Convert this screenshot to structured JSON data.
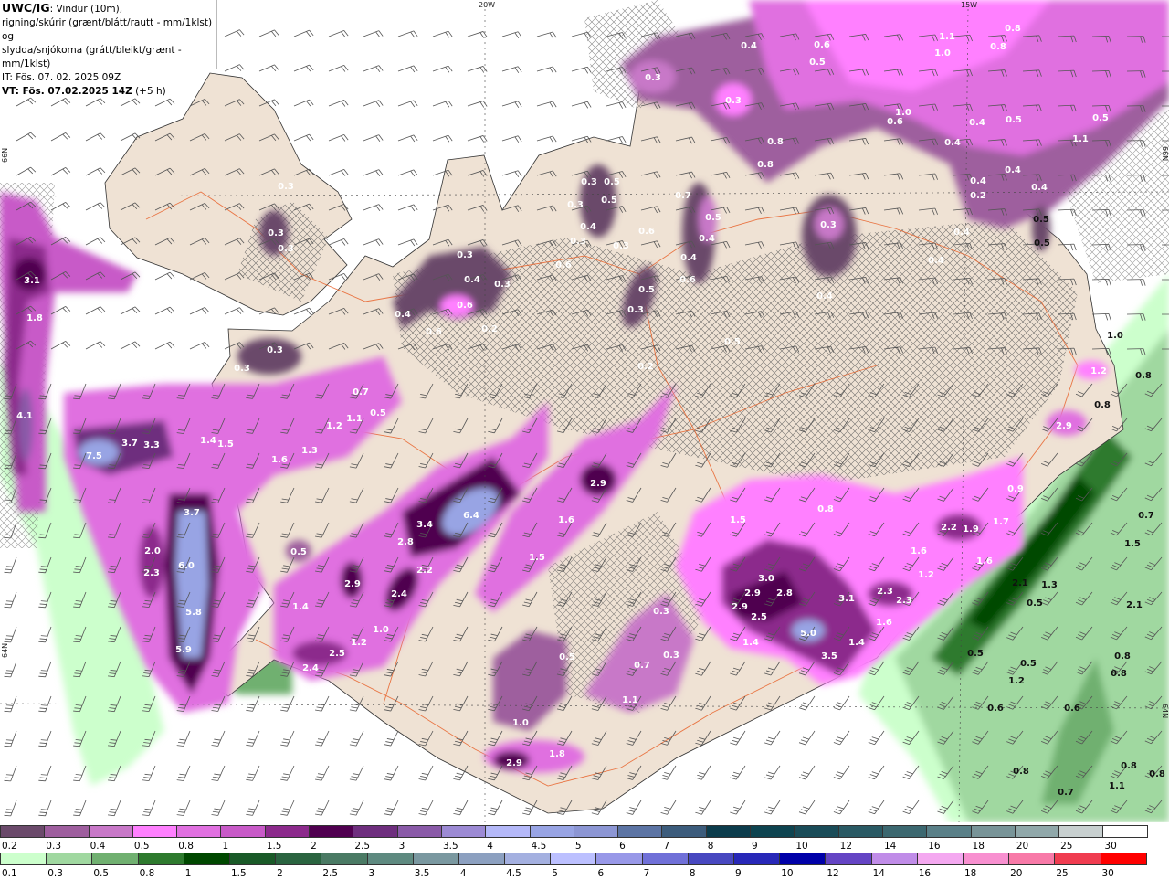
{
  "header": {
    "model": "UWC/IG",
    "line1_rest": ": Vindur (10m),",
    "line2": "rigning/skúrir (grænt/blátt/rautt - mm/1klst) og",
    "line3": "slydda/snjókoma (grátt/bleikt/grænt - mm/1klst)",
    "init_time": "IT: Fös. 07. 02. 2025 09Z",
    "valid_time_bold": "VT: Fös. 07.02.2025 14Z",
    "valid_offset": " (+5 h)"
  },
  "map": {
    "gridlabels": {
      "lon_20w": "20W",
      "lon_15w": "15W",
      "lat_66n_left": "66N",
      "lat_66n_right": "66N",
      "lat_64n_left": "64N",
      "lat_64n_right": "64N"
    },
    "colors": {
      "land": "#efe2d4",
      "sea": "#ffffff",
      "roads": "#e8622a",
      "wind_barbs": "#555555"
    },
    "labels": [
      {
        "v": "3.1",
        "c": "light"
      },
      {
        "v": "1.8",
        "c": "light"
      },
      {
        "v": "4.1",
        "c": "light"
      },
      {
        "v": "7.5",
        "c": "light"
      },
      {
        "v": "3.7",
        "c": "light"
      },
      {
        "v": "3.3",
        "c": "light"
      },
      {
        "v": "1.4",
        "c": "light"
      },
      {
        "v": "1.5",
        "c": "light"
      },
      {
        "v": "1.2",
        "c": "light"
      },
      {
        "v": "1.1",
        "c": "light"
      },
      {
        "v": "0.5",
        "c": "light"
      },
      {
        "v": "0.7",
        "c": "light"
      },
      {
        "v": "1.6",
        "c": "light"
      },
      {
        "v": "1.3",
        "c": "light"
      },
      {
        "v": "3.7",
        "c": "light"
      },
      {
        "v": "2.0",
        "c": "light"
      },
      {
        "v": "2.3",
        "c": "light"
      },
      {
        "v": "6.0",
        "c": "light"
      },
      {
        "v": "5.8",
        "c": "light"
      },
      {
        "v": "5.9",
        "c": "light"
      },
      {
        "v": "0.5",
        "c": "light"
      },
      {
        "v": "1.4",
        "c": "light"
      },
      {
        "v": "2.9",
        "c": "light"
      },
      {
        "v": "2.4",
        "c": "light"
      },
      {
        "v": "2.2",
        "c": "light"
      },
      {
        "v": "2.8",
        "c": "light"
      },
      {
        "v": "3.4",
        "c": "light"
      },
      {
        "v": "6.4",
        "c": "light"
      },
      {
        "v": "2.5",
        "c": "light"
      },
      {
        "v": "2.4",
        "c": "light"
      },
      {
        "v": "1.2",
        "c": "light"
      },
      {
        "v": "1.0",
        "c": "light"
      },
      {
        "v": "1.6",
        "c": "light"
      },
      {
        "v": "1.5",
        "c": "light"
      },
      {
        "v": "2.9",
        "c": "light"
      },
      {
        "v": "0.5",
        "c": "light"
      },
      {
        "v": "2.9",
        "c": "light"
      },
      {
        "v": "1.8",
        "c": "light"
      },
      {
        "v": "1.0",
        "c": "light"
      },
      {
        "v": "0.3",
        "c": "light"
      },
      {
        "v": "0.3",
        "c": "light"
      },
      {
        "v": "0.7",
        "c": "light"
      },
      {
        "v": "1.1",
        "c": "light"
      },
      {
        "v": "1.5",
        "c": "light"
      },
      {
        "v": "0.8",
        "c": "light"
      },
      {
        "v": "3.0",
        "c": "light"
      },
      {
        "v": "2.9",
        "c": "light"
      },
      {
        "v": "2.8",
        "c": "light"
      },
      {
        "v": "2.9",
        "c": "light"
      },
      {
        "v": "2.5",
        "c": "light"
      },
      {
        "v": "3.1",
        "c": "light"
      },
      {
        "v": "2.3",
        "c": "light"
      },
      {
        "v": "2.3",
        "c": "light"
      },
      {
        "v": "5.0",
        "c": "light"
      },
      {
        "v": "3.5",
        "c": "light"
      },
      {
        "v": "1.4",
        "c": "light"
      },
      {
        "v": "1.4",
        "c": "light"
      },
      {
        "v": "1.6",
        "c": "light"
      },
      {
        "v": "1.6",
        "c": "light"
      },
      {
        "v": "1.2",
        "c": "light"
      },
      {
        "v": "2.2",
        "c": "light"
      },
      {
        "v": "1.9",
        "c": "light"
      },
      {
        "v": "1.7",
        "c": "light"
      },
      {
        "v": "1.6",
        "c": "light"
      },
      {
        "v": "0.9",
        "c": "light"
      },
      {
        "v": "2.9",
        "c": "light"
      },
      {
        "v": "1.2",
        "c": "light"
      },
      {
        "v": "0.3",
        "c": "light"
      },
      {
        "v": "0.3",
        "c": "light"
      },
      {
        "v": "0.3",
        "c": "light"
      },
      {
        "v": "0.3",
        "c": "light"
      },
      {
        "v": "0.3",
        "c": "light"
      },
      {
        "v": "0.4",
        "c": "light"
      },
      {
        "v": "0.6",
        "c": "light"
      },
      {
        "v": "0.3",
        "c": "light"
      },
      {
        "v": "0.4",
        "c": "light"
      },
      {
        "v": "0.6",
        "c": "light"
      },
      {
        "v": "0.3",
        "c": "light"
      },
      {
        "v": "0.2",
        "c": "light"
      },
      {
        "v": "0.3",
        "c": "light"
      },
      {
        "v": "0.5",
        "c": "light"
      },
      {
        "v": "0.5",
        "c": "light"
      },
      {
        "v": "0.3",
        "c": "light"
      },
      {
        "v": "0.4",
        "c": "light"
      },
      {
        "v": "0.3",
        "c": "light"
      },
      {
        "v": "0.6",
        "c": "light"
      },
      {
        "v": "0.3",
        "c": "light"
      },
      {
        "v": "0.6",
        "c": "light"
      },
      {
        "v": "0.7",
        "c": "light"
      },
      {
        "v": "0.5",
        "c": "light"
      },
      {
        "v": "0.4",
        "c": "light"
      },
      {
        "v": "0.4",
        "c": "light"
      },
      {
        "v": "0.6",
        "c": "light"
      },
      {
        "v": "0.5",
        "c": "light"
      },
      {
        "v": "0.3",
        "c": "light"
      },
      {
        "v": "0.5",
        "c": "light"
      },
      {
        "v": "0.2",
        "c": "light"
      },
      {
        "v": "0.3",
        "c": "light"
      },
      {
        "v": "0.4",
        "c": "light"
      },
      {
        "v": "0.4",
        "c": "light"
      },
      {
        "v": "0.4",
        "c": "light"
      },
      {
        "v": "0.6",
        "c": "light"
      },
      {
        "v": "0.5",
        "c": "light"
      },
      {
        "v": "0.3",
        "c": "light"
      },
      {
        "v": "0.3",
        "c": "light"
      },
      {
        "v": "0.8",
        "c": "light"
      },
      {
        "v": "0.8",
        "c": "light"
      },
      {
        "v": "1.1",
        "c": "light"
      },
      {
        "v": "1.0",
        "c": "light"
      },
      {
        "v": "0.8",
        "c": "light"
      },
      {
        "v": "0.8",
        "c": "light"
      },
      {
        "v": "1.0",
        "c": "light"
      },
      {
        "v": "0.6",
        "c": "light"
      },
      {
        "v": "0.4",
        "c": "light"
      },
      {
        "v": "0.5",
        "c": "light"
      },
      {
        "v": "0.5",
        "c": "light"
      },
      {
        "v": "1.1",
        "c": "light"
      },
      {
        "v": "0.4",
        "c": "light"
      },
      {
        "v": "0.4",
        "c": "light"
      },
      {
        "v": "0.4",
        "c": "light"
      },
      {
        "v": "0.2",
        "c": "light"
      },
      {
        "v": "0.4",
        "c": "light"
      },
      {
        "v": "0.4",
        "c": "light"
      },
      {
        "v": "0.5",
        "c": "dark"
      },
      {
        "v": "0.5",
        "c": "dark"
      },
      {
        "v": "1.0",
        "c": "dark"
      },
      {
        "v": "0.8",
        "c": "dark"
      },
      {
        "v": "0.8",
        "c": "dark"
      },
      {
        "v": "0.7",
        "c": "dark"
      },
      {
        "v": "1.5",
        "c": "dark"
      },
      {
        "v": "2.1",
        "c": "dark"
      },
      {
        "v": "2.1",
        "c": "dark"
      },
      {
        "v": "1.3",
        "c": "dark"
      },
      {
        "v": "0.5",
        "c": "dark"
      },
      {
        "v": "0.5",
        "c": "dark"
      },
      {
        "v": "0.5",
        "c": "dark"
      },
      {
        "v": "1.2",
        "c": "dark"
      },
      {
        "v": "0.6",
        "c": "dark"
      },
      {
        "v": "0.6",
        "c": "dark"
      },
      {
        "v": "0.8",
        "c": "dark"
      },
      {
        "v": "0.8",
        "c": "dark"
      },
      {
        "v": "0.8",
        "c": "dark"
      },
      {
        "v": "0.8",
        "c": "dark"
      },
      {
        "v": "1.1",
        "c": "dark"
      },
      {
        "v": "0.8",
        "c": "dark"
      },
      {
        "v": "0.7",
        "c": "dark"
      }
    ]
  },
  "legend": {
    "snow": {
      "labels": [
        "0.2",
        "0.3",
        "0.4",
        "0.5",
        "0.8",
        "1",
        "1.5",
        "2",
        "2.5",
        "3",
        "3.5",
        "4",
        "4.5",
        "5",
        "6",
        "7",
        "8",
        "9",
        "10",
        "12",
        "14",
        "16",
        "18",
        "20",
        "25",
        "30"
      ],
      "colors": [
        "#6b4a6b",
        "#9e5e9e",
        "#c878c8",
        "#ff80ff",
        "#e070e0",
        "#c85ac8",
        "#8c2a8c",
        "#500050",
        "#6e2e7e",
        "#8a5aa8",
        "#9c8ad4",
        "#b4b8f8",
        "#98a4e4",
        "#8c96d4",
        "#5c74a4",
        "#3c5c7c",
        "#0c3c4c",
        "#0e4450",
        "#1a4c58",
        "#2a5a64",
        "#3c6870",
        "#5a8088",
        "#789498",
        "#90a8aa",
        "#c8d0d0",
        "#ffffff"
      ]
    },
    "rain": {
      "labels": [
        "0.1",
        "0.3",
        "0.5",
        "0.8",
        "1",
        "1.5",
        "2",
        "2.5",
        "3",
        "3.5",
        "4",
        "4.5",
        "5",
        "6",
        "7",
        "8",
        "9",
        "10",
        "12",
        "14",
        "16",
        "18",
        "20",
        "25",
        "30"
      ],
      "colors": [
        "#ccffcc",
        "#a0d8a0",
        "#70b070",
        "#2e7a2e",
        "#004800",
        "#1a5a28",
        "#2a6440",
        "#4a7a64",
        "#5e8a80",
        "#7a98a0",
        "#8ca0c0",
        "#a4b0e0",
        "#bcc0ff",
        "#9898e8",
        "#7070d8",
        "#4848c0",
        "#2828b8",
        "#0000a8",
        "#6444c4",
        "#c08ce8",
        "#f4a8f0",
        "#f890d0",
        "#f87aa8",
        "#f03c50",
        "#ff0000"
      ]
    }
  }
}
